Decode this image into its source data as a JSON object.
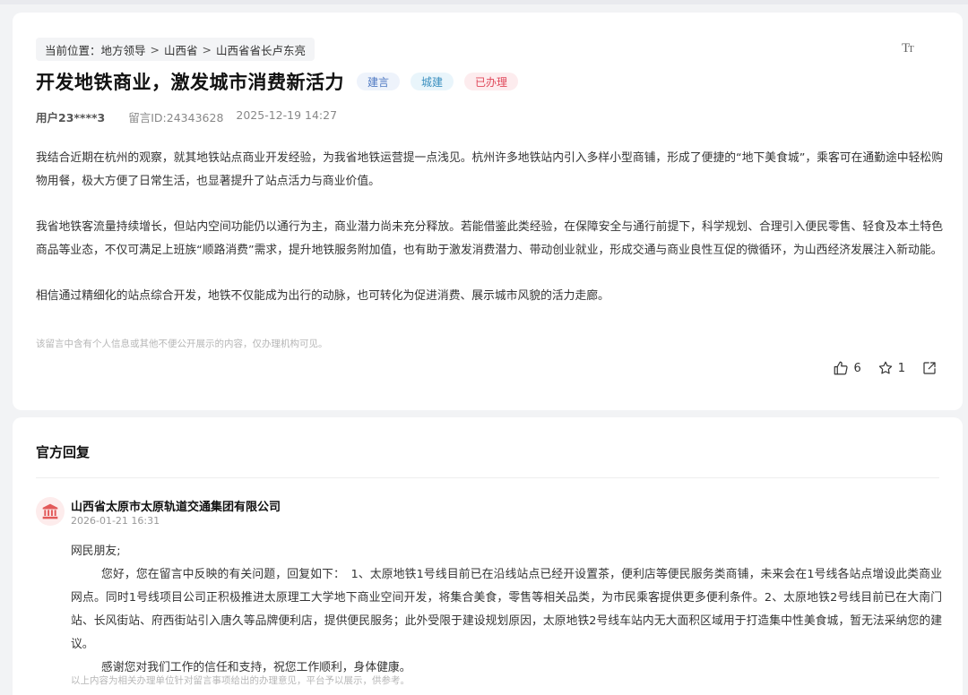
{
  "breadcrumb": {
    "prefix": "当前位置：",
    "items": [
      "地方领导",
      "山西省",
      "山西省省长卢东亮"
    ],
    "separator": ">"
  },
  "font_toggle": {
    "label_big": "T",
    "label_small": "T"
  },
  "message": {
    "title": "开发地铁商业，激发城市消费新活力",
    "tags": [
      "建言",
      "城建",
      "已办理"
    ],
    "user": "用户23****3",
    "message_id": "留言ID:24343628",
    "datetime": "2025-12-19 14:27",
    "paragraphs": [
      "我结合近期在杭州的观察，就其地铁站点商业开发经验，为我省地铁运营提一点浅见。杭州许多地铁站内引入多样小型商铺，形成了便捷的“地下美食城”，乘客可在通勤途中轻松购物用餐，极大方便了日常生活，也显著提升了站点活力与商业价值。",
      "我省地铁客流量持续增长，但站内空间功能仍以通行为主，商业潜力尚未充分释放。若能借鉴此类经验，在保障安全与通行前提下，科学规划、合理引入便民零售、轻食及本土特色商品等业态，不仅可满足上班族“顺路消费”需求，提升地铁服务附加值，也有助于激发消费潜力、带动创业就业，形成交通与商业良性互促的微循环，为山西经济发展注入新动能。",
      "相信通过精细化的站点综合开发，地铁不仅能成为出行的动脉，也可转化为促进消费、展示城市风貌的活力走廊。"
    ],
    "privacy_note": "该留言中含有个人信息或其他不便公开展示的内容，仅办理机构可见。",
    "like_count": "6",
    "favorite_count": "1",
    "icons": {
      "like": "thumbs-up-icon",
      "favorite": "star-icon",
      "share": "share-icon"
    }
  },
  "reply": {
    "heading": "官方回复",
    "org_name": "山西省太原市太原轨道交通集团有限公司",
    "org_icon": "government-building-icon",
    "datetime": "2026-01-21 16:31",
    "greeting": "网民朋友;",
    "body": "您好，您在留言中反映的有关问题，回复如下：　1、太原地铁1号线目前已在沿线站点已经开设置茶，便利店等便民服务类商铺，未来会在1号线各站点增设此类商业网点。同时1号线项目公司正积极推进太原理工大学地下商业空间开发，将集合美食，零售等相关品类，为市民乘客提供更多便利条件。2、太原地铁2号线目前已在大南门站、长风街站、府西街站引入唐久等品牌便利店，提供便民服务；此外受限于建设规划原因，太原地铁2号线车站内无大面积区域用于打造集中性美食城，暂无法采纳您的建议。",
    "closing": "感谢您对我们工作的信任和支持，祝您工作顺利，身体健康。",
    "note": "以上内容为相关办理单位针对留言事项给出的办理意见，平台予以展示，供参考。"
  },
  "colors": {
    "background": "#f2f3f5",
    "tag_blue_text": "#4d78c2",
    "tag_red_text": "#e0485a",
    "org_icon_color": "#e25a5a"
  }
}
